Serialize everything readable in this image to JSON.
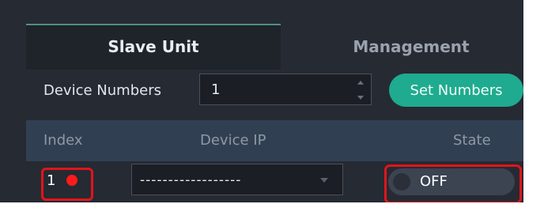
{
  "tabs": [
    {
      "label": "Slave Unit",
      "active": true
    },
    {
      "label": "Management",
      "active": false
    }
  ],
  "device_numbers": {
    "label": "Device Numbers",
    "value": "1",
    "button_label": "Set Numbers"
  },
  "table": {
    "headers": [
      "Index",
      "Device IP",
      "State"
    ],
    "rows": [
      {
        "index": "1",
        "device_ip": "------------------",
        "state": "OFF"
      }
    ]
  },
  "colors": {
    "accent": "#1fab8f",
    "status_dot": "#ff1b1b",
    "highlight_box": "#e0151b"
  }
}
